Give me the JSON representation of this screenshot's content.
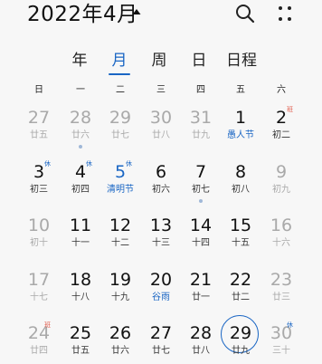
{
  "header": {
    "title": "2022年4月"
  },
  "tabs": [
    "年",
    "月",
    "周",
    "日",
    "日程"
  ],
  "active_tab": 1,
  "weekdays": [
    "日",
    "一",
    "二",
    "三",
    "四",
    "五",
    "六"
  ],
  "weeks": [
    [
      {
        "d": "27",
        "sub": "廿五",
        "other": true
      },
      {
        "d": "28",
        "sub": "廿六",
        "other": true,
        "dot": true
      },
      {
        "d": "29",
        "sub": "廿七",
        "other": true
      },
      {
        "d": "30",
        "sub": "廿八",
        "other": true
      },
      {
        "d": "31",
        "sub": "廿九",
        "other": true
      },
      {
        "d": "1",
        "sub": "愚人节",
        "festival": true
      },
      {
        "d": "2",
        "sub": "初二",
        "badge": "班",
        "badge_type": "work"
      }
    ],
    [
      {
        "d": "3",
        "sub": "初三",
        "badge": "休",
        "badge_type": "rest"
      },
      {
        "d": "4",
        "sub": "初四",
        "badge": "休",
        "badge_type": "rest"
      },
      {
        "d": "5",
        "sub": "清明节",
        "festival": true,
        "badge": "休",
        "badge_type": "rest",
        "num_color": "#1a66c4"
      },
      {
        "d": "6",
        "sub": "初六"
      },
      {
        "d": "7",
        "sub": "初七",
        "dot": true
      },
      {
        "d": "8",
        "sub": "初八"
      },
      {
        "d": "9",
        "sub": "初九",
        "other": true
      }
    ],
    [
      {
        "d": "10",
        "sub": "初十",
        "other": true
      },
      {
        "d": "11",
        "sub": "十一"
      },
      {
        "d": "12",
        "sub": "十二"
      },
      {
        "d": "13",
        "sub": "十三"
      },
      {
        "d": "14",
        "sub": "十四"
      },
      {
        "d": "15",
        "sub": "十五"
      },
      {
        "d": "16",
        "sub": "十六",
        "other": true
      }
    ],
    [
      {
        "d": "17",
        "sub": "十七",
        "other": true
      },
      {
        "d": "18",
        "sub": "十八"
      },
      {
        "d": "19",
        "sub": "十九"
      },
      {
        "d": "20",
        "sub": "谷雨",
        "festival": true
      },
      {
        "d": "21",
        "sub": "廿一"
      },
      {
        "d": "22",
        "sub": "廿二"
      },
      {
        "d": "23",
        "sub": "廿三",
        "other": true
      }
    ],
    [
      {
        "d": "24",
        "sub": "廿四",
        "other": true,
        "badge": "班",
        "badge_type": "work"
      },
      {
        "d": "25",
        "sub": "廿五"
      },
      {
        "d": "26",
        "sub": "廿六"
      },
      {
        "d": "27",
        "sub": "廿七"
      },
      {
        "d": "28",
        "sub": "廿八"
      },
      {
        "d": "29",
        "sub": "廿九",
        "today": true
      },
      {
        "d": "30",
        "sub": "三十",
        "other": true,
        "badge": "休",
        "badge_type": "rest"
      }
    ]
  ],
  "colors": {
    "accent": "#1a66c4",
    "holiday_work": "#e05a4a"
  }
}
